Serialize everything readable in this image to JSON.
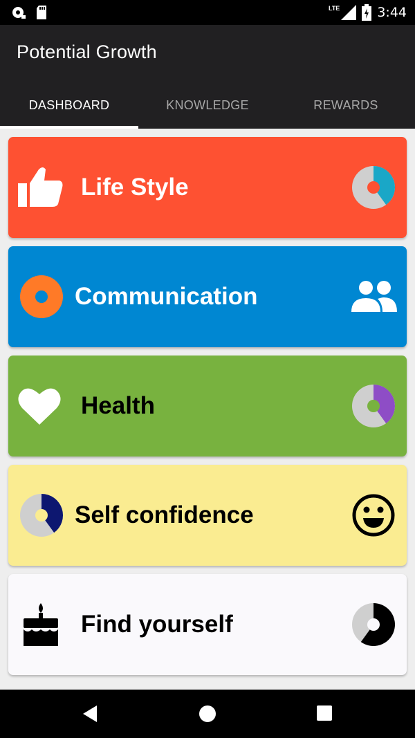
{
  "status_bar": {
    "time": "3:44",
    "network": "LTE",
    "icons": [
      "notification-icon",
      "sd-card-icon",
      "signal-icon",
      "battery-icon"
    ]
  },
  "app": {
    "title": "Potential Growth"
  },
  "tabs": [
    {
      "label": "DASHBOARD",
      "active": true
    },
    {
      "label": "KNOWLEDGE",
      "active": false
    },
    {
      "label": "REWARDS",
      "active": false
    }
  ],
  "cards": [
    {
      "label": "Life Style",
      "color": "#fe5132",
      "text_color": "#ffffff",
      "left_icon": "thumbs-up-icon",
      "right_icon": "progress-ring-icon",
      "progress_fraction": 0.4
    },
    {
      "label": "Communication",
      "color": "#0087d2",
      "text_color": "#ffffff",
      "left_icon": "progress-ring-icon",
      "right_icon": "people-icon",
      "progress_fraction": 0
    },
    {
      "label": "Health",
      "color": "#78b23f",
      "text_color": "#000000",
      "left_icon": "heart-icon",
      "right_icon": "progress-ring-icon",
      "progress_fraction": 0.4
    },
    {
      "label": "Self confidence",
      "color": "#faec91",
      "text_color": "#000000",
      "left_icon": "progress-ring-icon",
      "right_icon": "smiley-icon",
      "progress_fraction": 0.4
    },
    {
      "label": "Find yourself",
      "color": "#faf9fc",
      "text_color": "#000000",
      "left_icon": "cake-icon",
      "right_icon": "progress-ring-icon",
      "progress_fraction": 0.6
    }
  ],
  "nav_bar": {
    "buttons": [
      "back-icon",
      "home-icon",
      "recents-icon"
    ]
  }
}
